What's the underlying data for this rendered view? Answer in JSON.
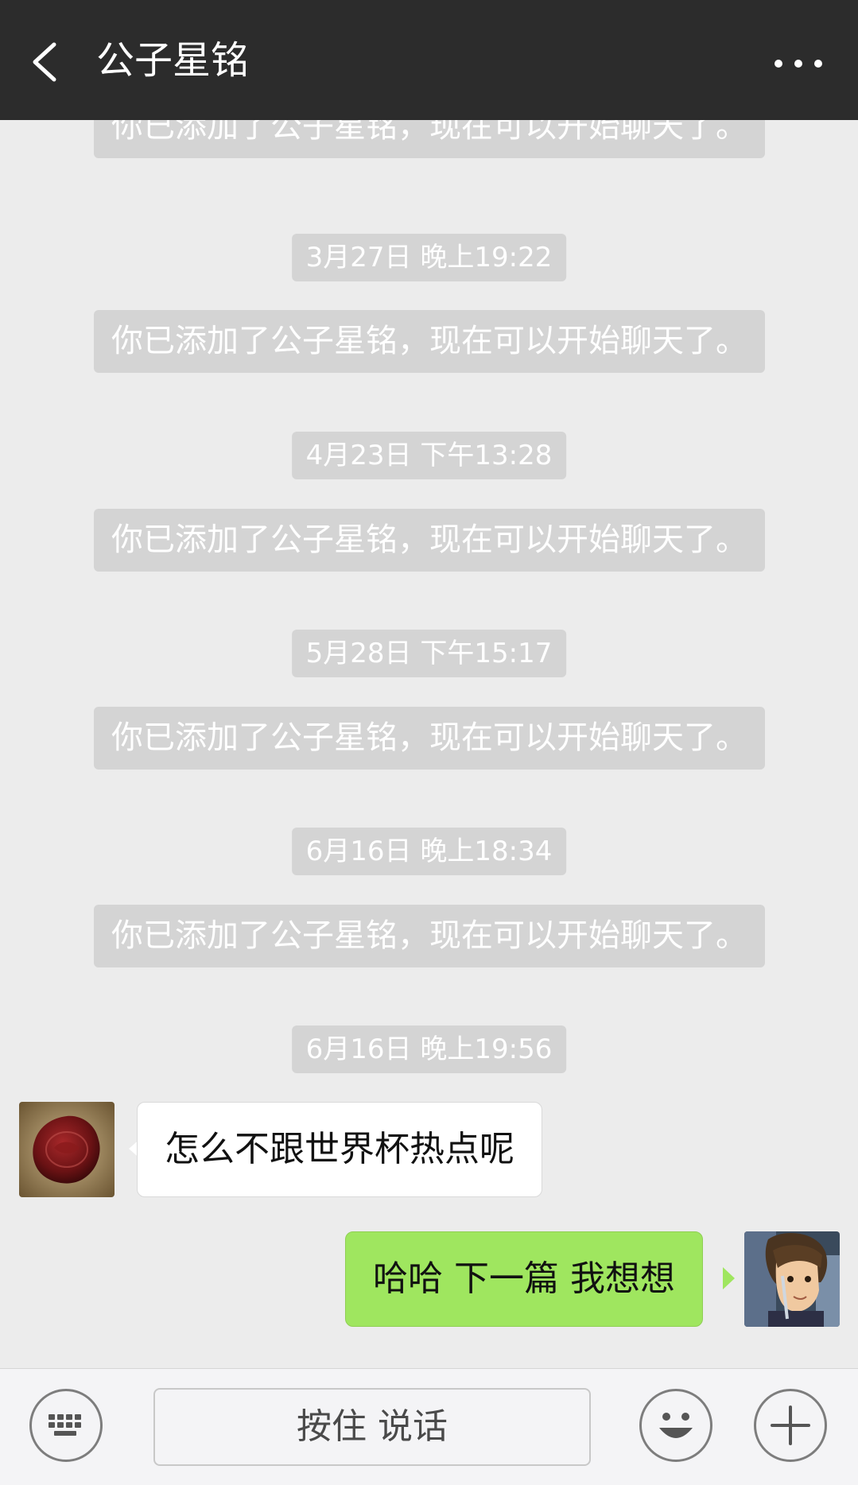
{
  "header": {
    "back_icon": "chevron-left-icon",
    "title": "公子星铭",
    "more_icon": "more-dots-icon"
  },
  "messages": [
    {
      "kind": "system",
      "text": "你已添加了公子星铭，现在可以开始聊天了。"
    },
    {
      "kind": "time",
      "text": "3月27日 晚上19:22"
    },
    {
      "kind": "system",
      "text": "你已添加了公子星铭，现在可以开始聊天了。"
    },
    {
      "kind": "time",
      "text": "4月23日 下午13:28"
    },
    {
      "kind": "system",
      "text": "你已添加了公子星铭，现在可以开始聊天了。"
    },
    {
      "kind": "time",
      "text": "5月28日 下午15:17"
    },
    {
      "kind": "system",
      "text": "你已添加了公子星铭，现在可以开始聊天了。"
    },
    {
      "kind": "time",
      "text": "6月16日 晚上18:34"
    },
    {
      "kind": "system",
      "text": "你已添加了公子星铭，现在可以开始聊天了。"
    },
    {
      "kind": "time",
      "text": "6月16日 晚上19:56"
    },
    {
      "kind": "incoming",
      "text": "怎么不跟世界杯热点呢"
    },
    {
      "kind": "outgoing",
      "text": "哈哈 下一篇 我想想"
    }
  ],
  "input_bar": {
    "keyboard_icon": "keyboard-icon",
    "hold_to_talk": "按住 说话",
    "emoji_icon": "emoji-icon",
    "add_icon": "plus-icon"
  },
  "colors": {
    "header_bg": "#2c2c2c",
    "chat_bg": "#ececec",
    "system_bubble": "#d4d4d4",
    "outgoing_bubble": "#9fe65f",
    "incoming_bubble": "#ffffff"
  }
}
